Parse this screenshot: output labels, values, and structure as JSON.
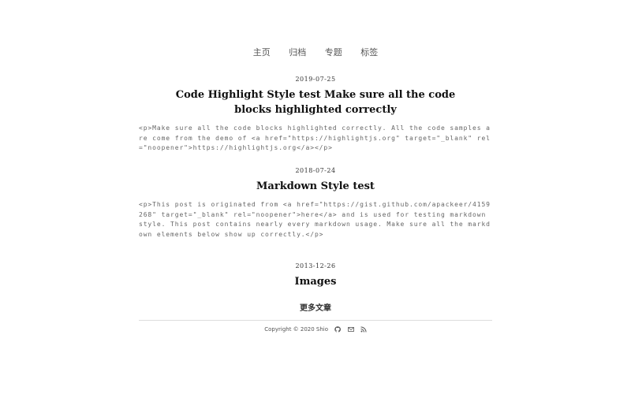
{
  "nav": {
    "items": [
      {
        "label": "主页"
      },
      {
        "label": "归档"
      },
      {
        "label": "专题"
      },
      {
        "label": "标签"
      }
    ]
  },
  "posts": [
    {
      "date": "2019-07-25",
      "title": "Code Highlight Style test Make sure all the code blocks highlighted correctly",
      "excerpt": "<p>Make sure all the code blocks highlighted correctly. All the code samples are come from the demo of <a href=\"https://highlightjs.org\" target=\"_blank\" rel=\"noopener\">https://highlightjs.org</a></p>"
    },
    {
      "date": "2018-07-24",
      "title": "Markdown Style test",
      "excerpt": "<p>This post is originated from <a href=\"https://gist.github.com/apackeer/4159268\" target=\"_blank\" rel=\"noopener\">here</a> and is used for testing markdown style. This post contains nearly every markdown usage. Make sure all the markdown elements below show up correctly.</p>"
    },
    {
      "date": "2013-12-26",
      "title": "Images",
      "excerpt": ""
    }
  ],
  "more_label": "更多文章",
  "footer": {
    "copyright": "Copyright © 2020 Shio",
    "icons": [
      "github-icon",
      "mail-icon",
      "rss-icon"
    ]
  }
}
